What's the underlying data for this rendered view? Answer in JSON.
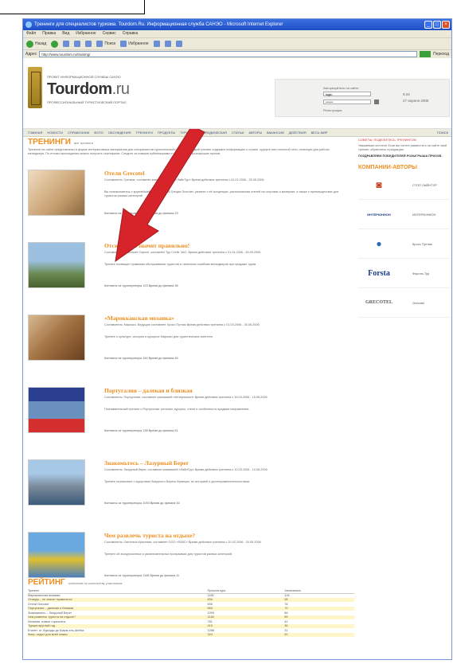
{
  "window": {
    "title": "Тренинги для специалистов туризма. Tourdom.Ru. Информационная служба САНЭО - Microsoft Internet Explorer",
    "menu": [
      "Файл",
      "Правка",
      "Вид",
      "Избранное",
      "Сервис",
      "Справка"
    ],
    "toolbar": [
      "Назад",
      "Поиск",
      "Избранное"
    ],
    "address_label": "Адрес",
    "address": "http://www.tourdom.ru/training/",
    "go_label": "Переход"
  },
  "header": {
    "logo_sub": "ПРОЕКТ ИНФОРМАЦИОННОЙ СЛУЖБЫ САНЭО",
    "logo_main": "Tourdom",
    "logo_ru": ".ru",
    "logo_tag": "ПРОФЕССИОНАЛЬНЫЙ ТУРИСТИЧЕСКИЙ ПОРТАЛ",
    "login_label": "Авторизуйтесь на сайте",
    "login_value": "login",
    "password_value": "******",
    "register_label": "Регистрация",
    "date_time": "9:44",
    "date_day": "27 апреля 2006"
  },
  "nav": {
    "items": [
      "ГЛАВНАЯ",
      "НОВОСТИ",
      "СПРАВОЧНИК",
      "ФОТО",
      "ОБСУЖДЕНИЯ",
      "ТРЕНИНГИ",
      "ПРОДУКТЫ",
      "ТУРИСТАМ",
      "ЮРИДИЧЕСКАЯ",
      "СТАТЬИ",
      "АВТОРЫ",
      "ВАКАНСИИ",
      "ДЕЙСТВИЯ",
      "ВЕСЬ МИР"
    ],
    "search": "ПОИСК"
  },
  "trainings": {
    "title": "ТРЕНИНГИ",
    "subtitle": "все тренинги",
    "intro": "Тренинги на сайте представлены в форме интерактивных материалов для специалистов туристической отрасли. Каждый тренинг содержит информацию о стране, курорте или отельной сети, полезную для работы менеджера. По итогам прохождения можно получить сертификат. Следите за новыми публикациями и участвуйте в розыгрышах призов.",
    "items": [
      {
        "title": "Отели Grecotel",
        "meta": "Составитель: Гречков, составлен компанией «Стоп ЛайнТур» Время действия тренинга с 01.02.2006 - 30.05.2006",
        "desc": "Вы познакомитесь с крупнейшей сетью отелей Греции Grecotel, узнаете о её концепции, расположении отелей на островах и материке, а также о преимуществах для туристов разных категорий.",
        "foot": "Контакты из туроператоры 245 Время до финала 23"
      },
      {
        "title": "Отсюда – не значит правильно!",
        "meta": "Составитель: Шапочкин Сергей, составлен Тур Стейт ЗАО. Время действия тренинга с 01.04.2006 - 30.05.2006",
        "desc": "Тренинг посвящен правилам обслуживания туристов и типичным ошибкам менеджеров при продаже туров.",
        "foot": "Контакты из туроператоры 123 Время до финала 36"
      },
      {
        "title": "«Марокканская мозаика»",
        "meta": "Составитель: Марокко. Ведущие составлен: Кросс Путник Время действия тренинга с 01.03.2006 - 30.06.2006",
        "desc": "Тренинг о культуре, истории и курортах Марокко для туристических агентств.",
        "foot": "Контакты из туроператоры 150 Время до финала 45"
      },
      {
        "title": "Португалия – далекая и близкая",
        "meta": "Составитель: Португалия, составлен компанией «Интерюнион» Время действия тренинга с 15.03.2006 - 15.06.2006",
        "desc": "Познавательный тренинг о Португалии: регионы, курорты, отели и особенности продажи направления.",
        "foot": "Контакты из туроператоры 138 Время до финала 51"
      },
      {
        "title": "Знакомьтесь – Лазурный Берег",
        "meta": "Составитель: Лазурный берег, составлен компанией «ЛайнТур» Время действия тренинга с 10.03.2006 - 10.06.2006",
        "desc": "Тренинг познакомит с курортами Лазурного Берега Франции, их историей и достопримечательностями.",
        "foot": "Контакты из туроператоры 1093 Время до финала 16"
      },
      {
        "title": "Чем развлечь туриста на отдыхе?",
        "meta": "Составитель: Светлана Краснова, составлен ООО «ПАКС» Время действия тренинга с 20.02.2006 - 20.05.2006",
        "desc": "Тренинг об экскурсионных и развлекательных программах для туристов разных категорий.",
        "foot": "Контакты из туроператоры 1148 Время до финала 11"
      }
    ]
  },
  "sidebar": {
    "link": "СОВЕТЫ: ПОДЕЛИТЕСЬ ТРЕНИНГОМ",
    "text1": "Уважаемые коллеги! Если вы хотите разместить на сайте свой тренинг, обратитесь в редакцию.",
    "text2": "ПОЗДРАВЛЯЕМ ПОБЕДИТЕЛЕЙ РОЗЫГРЫША ПРИЗОВ.",
    "companies_title": "КОМПАНИИ-АВТОРЫ",
    "companies": [
      {
        "logo": "◙",
        "name": "СТОП ЛАЙНТУР"
      },
      {
        "logo": "ИНТЕРЮНИОН",
        "name": "ИНТЕРЮНИОН"
      },
      {
        "logo": "●",
        "name": "Кросс Путник"
      },
      {
        "logo": "Forsta",
        "name": "Форста-Тур"
      },
      {
        "logo": "GRECOTEL",
        "name": "Grecotel"
      }
    ]
  },
  "rating": {
    "title": "РЕЙТИНГ",
    "subtitle": "тренингов по количеству участников",
    "headers": [
      "Тренинг",
      "Прошли курс",
      "Записались"
    ],
    "rows": [
      [
        "Марокканская мозаика",
        "1150",
        "134"
      ],
      [
        "Отсюда – не значит правильно!",
        "834",
        "98"
      ],
      [
        "Отели Grecotel",
        "595",
        "76"
      ],
      [
        "Португалия – далекая и близкая",
        "563",
        "70"
      ],
      [
        "Знакомьтесь – Лазурный Берег",
        "1093",
        "66"
      ],
      [
        "Чем развлечь туриста на отдыхе?",
        "1148",
        "59"
      ],
      [
        "Испания: новые горизонты",
        "781",
        "42"
      ],
      [
        "Турция круглый год",
        "415",
        "36"
      ],
      [
        "Египет: от Хургады до Шарм-эль-Шейха",
        "1286",
        "31"
      ],
      [
        "Кипр: отдых для всей семьи",
        "324",
        "20"
      ]
    ]
  },
  "colors": {
    "accent": "#ef8e1e",
    "arrow": "#d7242a",
    "titlebar": "#2b5fd8"
  }
}
